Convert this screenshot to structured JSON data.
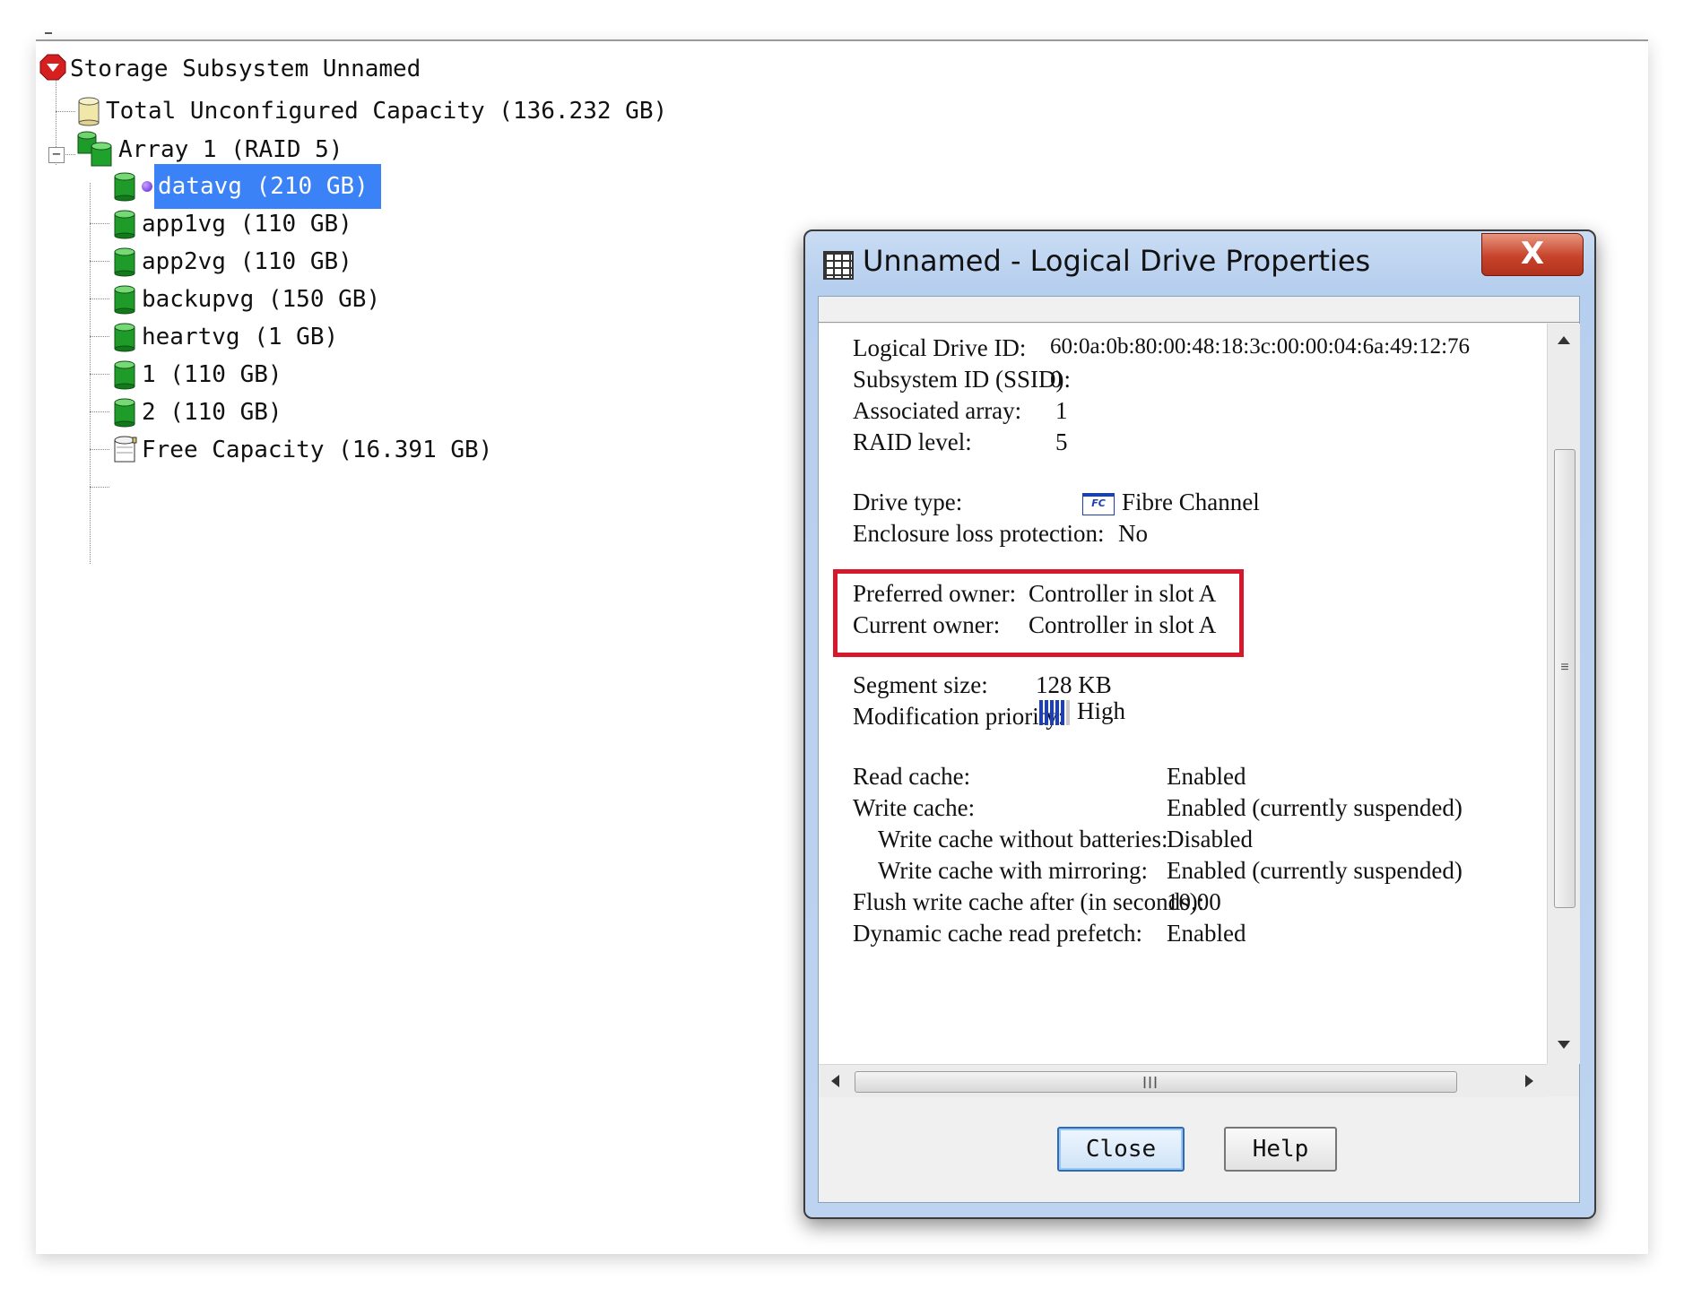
{
  "tree": {
    "root": "Storage Subsystem Unnamed",
    "unconfigured": "Total Unconfigured Capacity (136.232 GB)",
    "array": "Array 1 (RAID 5)",
    "drives": [
      "datavg (210 GB)",
      "app1vg (110 GB)",
      "app2vg (110 GB)",
      "backupvg (150 GB)",
      "heartvg (1 GB)",
      "1 (110 GB)",
      "2 (110 GB)"
    ],
    "free": "Free Capacity (16.391 GB)",
    "expander_symbol": "−"
  },
  "dialog": {
    "title": "Unnamed - Logical Drive Properties",
    "close_symbol": "X",
    "properties": {
      "logical_drive_id_label": "Logical Drive ID:",
      "logical_drive_id_value": "60:0a:0b:80:00:48:18:3c:00:00:04:6a:49:12:76",
      "ssid_label": "Subsystem ID (SSID):",
      "ssid_value": "0",
      "associated_array_label": "Associated array:",
      "associated_array_value": "1",
      "raid_level_label": "RAID level:",
      "raid_level_value": "5",
      "drive_type_label": "Drive type:",
      "drive_type_icon_text": "FC",
      "drive_type_value": "Fibre Channel",
      "enclosure_label": "Enclosure loss protection:",
      "enclosure_value": "No",
      "preferred_owner_label": "Preferred owner:",
      "preferred_owner_value": "Controller in slot A",
      "current_owner_label": "Current owner:",
      "current_owner_value": "Controller in slot A",
      "segment_size_label": "Segment size:",
      "segment_size_value": "128 KB",
      "mod_priority_label": "Modification priority:",
      "mod_priority_value": "High",
      "read_cache_label": "Read cache:",
      "read_cache_value": "Enabled",
      "write_cache_label": "Write cache:",
      "write_cache_value": "Enabled (currently suspended)",
      "wc_no_batt_label": "Write cache without batteries:",
      "wc_no_batt_value": "Disabled",
      "wc_mirror_label": "Write cache with mirroring:",
      "wc_mirror_value": "Enabled (currently suspended)",
      "flush_label": "Flush write cache after (in seconds):",
      "flush_value": "10.00",
      "dyn_prefetch_label": "Dynamic cache read prefetch:",
      "dyn_prefetch_value": "Enabled"
    },
    "buttons": {
      "close": "Close",
      "help": "Help"
    },
    "scroll_grip": "III"
  }
}
